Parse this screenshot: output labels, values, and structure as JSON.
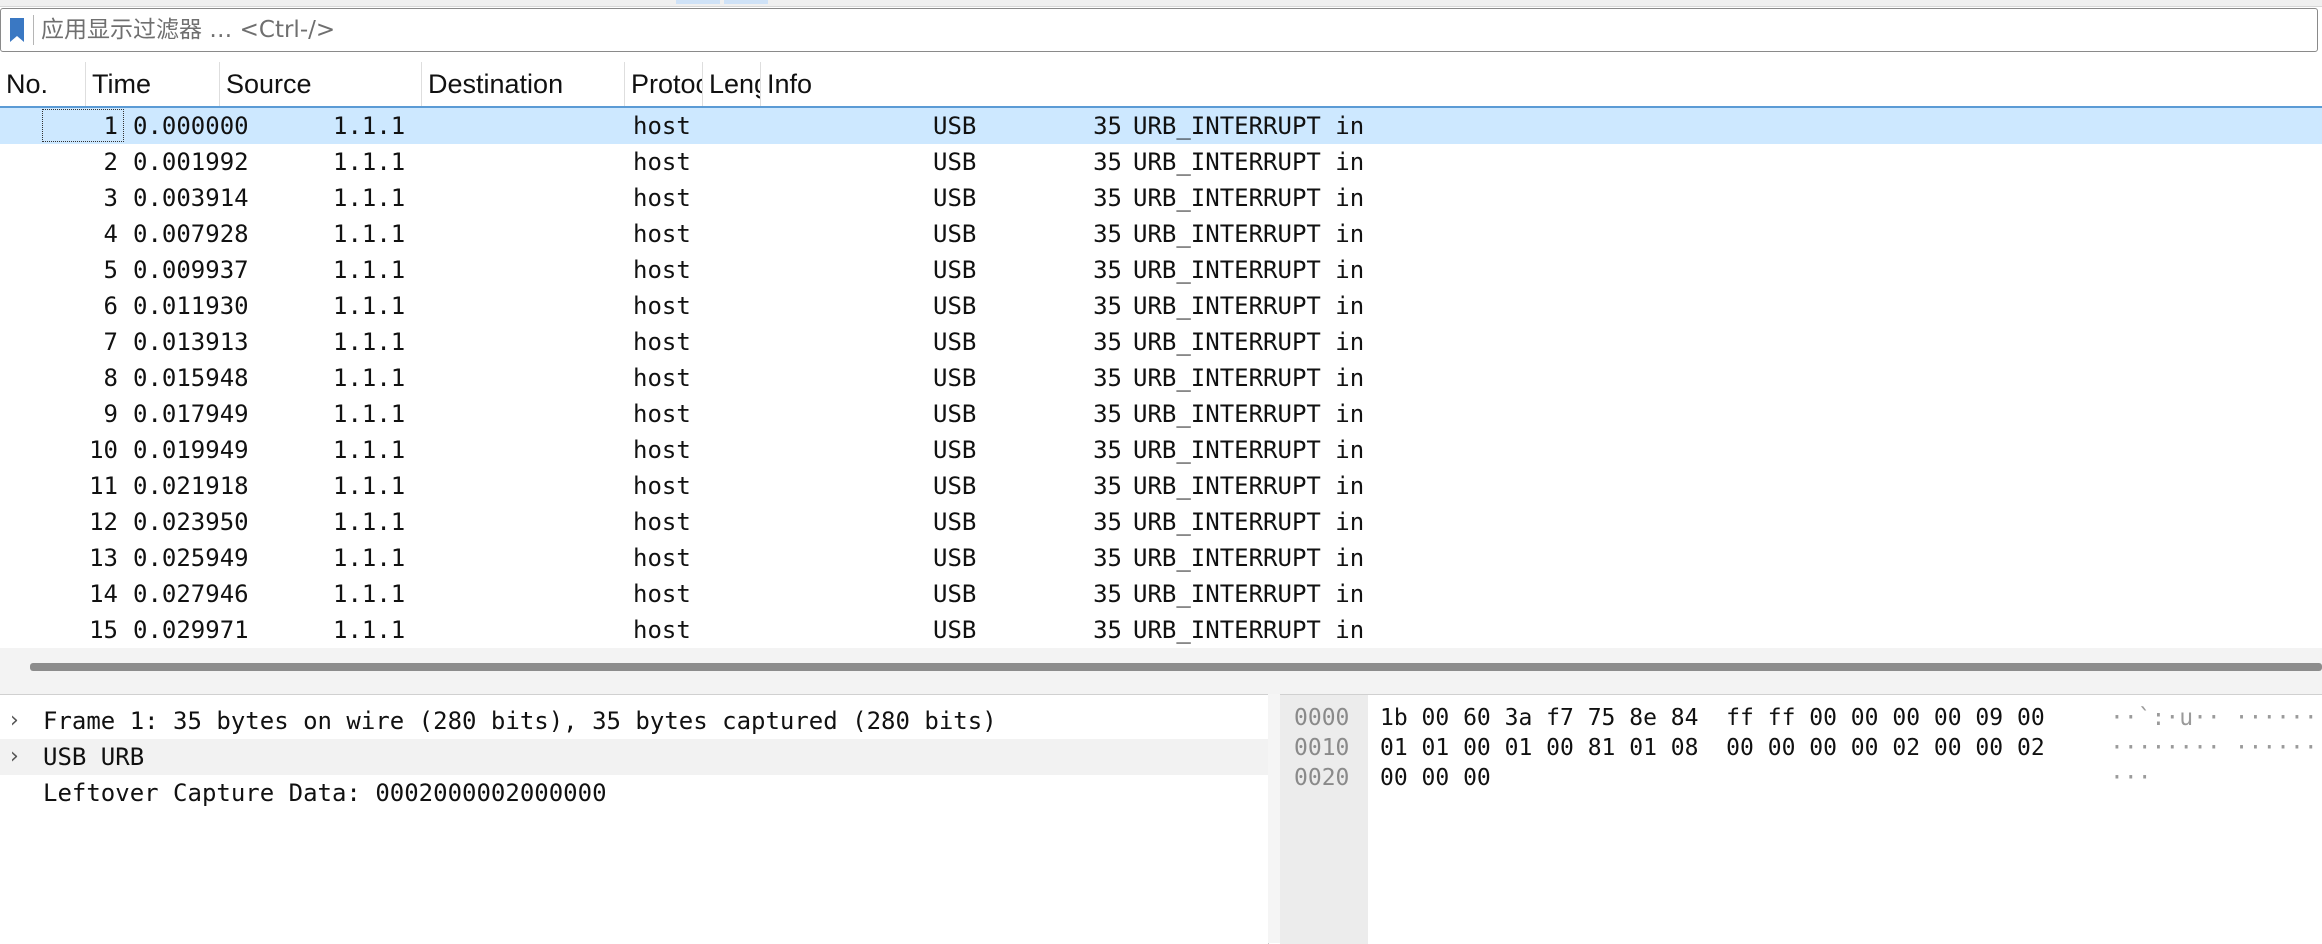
{
  "filter": {
    "placeholder": "应用显示过滤器 … <Ctrl-/>"
  },
  "columns": [
    "No.",
    "Time",
    "Source",
    "Destination",
    "Protoco",
    "Lengt",
    "Info"
  ],
  "packets": [
    {
      "no": "1",
      "time": "0.000000",
      "source": "1.1.1",
      "destination": "host",
      "protocol": "USB",
      "length": "35",
      "info": "URB_INTERRUPT in"
    },
    {
      "no": "2",
      "time": "0.001992",
      "source": "1.1.1",
      "destination": "host",
      "protocol": "USB",
      "length": "35",
      "info": "URB_INTERRUPT in"
    },
    {
      "no": "3",
      "time": "0.003914",
      "source": "1.1.1",
      "destination": "host",
      "protocol": "USB",
      "length": "35",
      "info": "URB_INTERRUPT in"
    },
    {
      "no": "4",
      "time": "0.007928",
      "source": "1.1.1",
      "destination": "host",
      "protocol": "USB",
      "length": "35",
      "info": "URB_INTERRUPT in"
    },
    {
      "no": "5",
      "time": "0.009937",
      "source": "1.1.1",
      "destination": "host",
      "protocol": "USB",
      "length": "35",
      "info": "URB_INTERRUPT in"
    },
    {
      "no": "6",
      "time": "0.011930",
      "source": "1.1.1",
      "destination": "host",
      "protocol": "USB",
      "length": "35",
      "info": "URB_INTERRUPT in"
    },
    {
      "no": "7",
      "time": "0.013913",
      "source": "1.1.1",
      "destination": "host",
      "protocol": "USB",
      "length": "35",
      "info": "URB_INTERRUPT in"
    },
    {
      "no": "8",
      "time": "0.015948",
      "source": "1.1.1",
      "destination": "host",
      "protocol": "USB",
      "length": "35",
      "info": "URB_INTERRUPT in"
    },
    {
      "no": "9",
      "time": "0.017949",
      "source": "1.1.1",
      "destination": "host",
      "protocol": "USB",
      "length": "35",
      "info": "URB_INTERRUPT in"
    },
    {
      "no": "10",
      "time": "0.019949",
      "source": "1.1.1",
      "destination": "host",
      "protocol": "USB",
      "length": "35",
      "info": "URB_INTERRUPT in"
    },
    {
      "no": "11",
      "time": "0.021918",
      "source": "1.1.1",
      "destination": "host",
      "protocol": "USB",
      "length": "35",
      "info": "URB_INTERRUPT in"
    },
    {
      "no": "12",
      "time": "0.023950",
      "source": "1.1.1",
      "destination": "host",
      "protocol": "USB",
      "length": "35",
      "info": "URB_INTERRUPT in"
    },
    {
      "no": "13",
      "time": "0.025949",
      "source": "1.1.1",
      "destination": "host",
      "protocol": "USB",
      "length": "35",
      "info": "URB_INTERRUPT in"
    },
    {
      "no": "14",
      "time": "0.027946",
      "source": "1.1.1",
      "destination": "host",
      "protocol": "USB",
      "length": "35",
      "info": "URB_INTERRUPT in"
    },
    {
      "no": "15",
      "time": "0.029971",
      "source": "1.1.1",
      "destination": "host",
      "protocol": "USB",
      "length": "35",
      "info": "URB_INTERRUPT in"
    }
  ],
  "selected_packet": "1",
  "details": [
    {
      "text": "Frame 1: 35 bytes on wire (280 bits), 35 bytes captured (280 bits)",
      "expandable": true
    },
    {
      "text": "USB URB",
      "expandable": true
    },
    {
      "text": "Leftover Capture Data: 0002000002000000",
      "expandable": false
    }
  ],
  "bytes": [
    {
      "offset": "0000",
      "hex": "1b 00 60 3a f7 75 8e 84  ff ff 00 00 00 00 09 00",
      "ascii": "··`:·u·· ········"
    },
    {
      "offset": "0010",
      "hex": "01 01 00 01 00 81 01 08  00 00 00 00 02 00 00 02",
      "ascii": "········ ········"
    },
    {
      "offset": "0020",
      "hex": "00 00 00",
      "ascii": "···"
    }
  ],
  "colors": {
    "selected_row": "#cde8ff",
    "header_underline": "#5b9bd5",
    "bookmark": "#3a78c3"
  },
  "icons": {
    "filter_bookmark": "bookmark-icon",
    "expand": "chevron-right-icon"
  }
}
